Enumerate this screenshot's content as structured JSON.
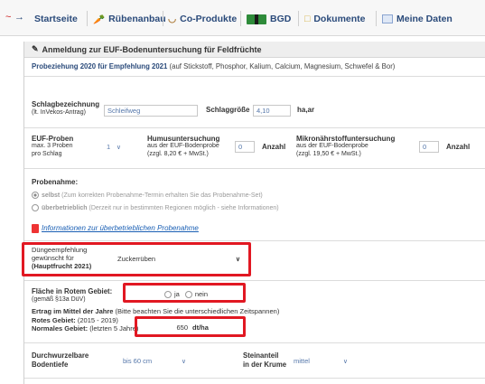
{
  "nav": {
    "items": [
      {
        "label": "Startseite",
        "icon": "home-icon"
      },
      {
        "label": "Rübenanbau",
        "icon": "beet-icon"
      },
      {
        "label": "Co-Produkte",
        "icon": "bowl-icon"
      },
      {
        "label": "BGD",
        "icon": "bgd-icon"
      },
      {
        "label": "Dokumente",
        "icon": "folder-icon"
      },
      {
        "label": "Meine Daten",
        "icon": "data-icon"
      }
    ]
  },
  "panel": {
    "title": "Anmeldung zur EUF-Bodenuntersuchung für Feldfrüchte",
    "subtitle_bold": "Probeziehung 2020 für Empfehlung 2021",
    "subtitle_rest": " (auf Stickstoff, Phosphor, Kalium, Calcium, Magnesium, Schwefel & Bor)"
  },
  "schlag": {
    "label": "Schlagbezeichnung",
    "sublabel": "(lt. InVekos-Antrag)",
    "value": "Schleifweg",
    "groesse_label": "Schlaggröße",
    "groesse_value": "4,10",
    "groesse_unit": "ha,ar"
  },
  "proben": {
    "euf_label": "EUF-Proben",
    "euf_line2": "max. 3 Proben",
    "euf_line3": "pro Schlag",
    "euf_value": "1",
    "humus_label": "Humusuntersuchung",
    "humus_line2": "aus der EUF-Bodenprobe",
    "humus_line3": "(zzgl. 8,20 € + MwSt.)",
    "humus_value": "0",
    "humus_anzahl": "Anzahl",
    "mikro_label": "Mikronährstoffuntersuchung",
    "mikro_line2": "aus der EUF-Bodenprobe",
    "mikro_line3": "(zzgl. 19,50 € + MwSt.)",
    "mikro_value": "0",
    "mikro_anzahl": "Anzahl"
  },
  "probenahme": {
    "label": "Probenahme:",
    "option1_bold": "selbst",
    "option1_rest": " (Zum korrekten Probenahme-Termin erhalten Sie das Probenahme-Set)",
    "option2_bold": "überbetrieblich",
    "option2_rest": " (Derzeit nur in bestimmten Regionen möglich - siehe Informationen)",
    "link": "Informationen zur überbetrieblichen Probenahme"
  },
  "duenge": {
    "line1": "Düngeempfehlung",
    "line2": "gewünscht für",
    "line3": "(Hauptfrucht 2021)",
    "value": "Zuckerrüben"
  },
  "flaeche": {
    "label": "Fläche in Rotem Gebiet:",
    "sublabel": "(gemäß §13a DüV)",
    "ja": "ja",
    "nein": "nein"
  },
  "ertrag": {
    "title_bold": "Ertrag im Mittel der Jahre",
    "title_rest": " (Bitte beachten Sie die unterschiedlichen Zeitspannen)",
    "rotes_bold": "Rotes Gebiet:",
    "rotes_rest": " (2015 - 2019)",
    "normal_bold": "Normales Gebiet:",
    "normal_rest": " (letzten 5 Jahre)",
    "value": "650",
    "unit": "dt/ha"
  },
  "boden": {
    "line1": "Durchwurzelbare",
    "line2": "Bodentiefe",
    "value": "bis 60 cm",
    "stein_line1": "Steinanteil",
    "stein_line2": "in der Krume",
    "stein_value": "mittel"
  }
}
